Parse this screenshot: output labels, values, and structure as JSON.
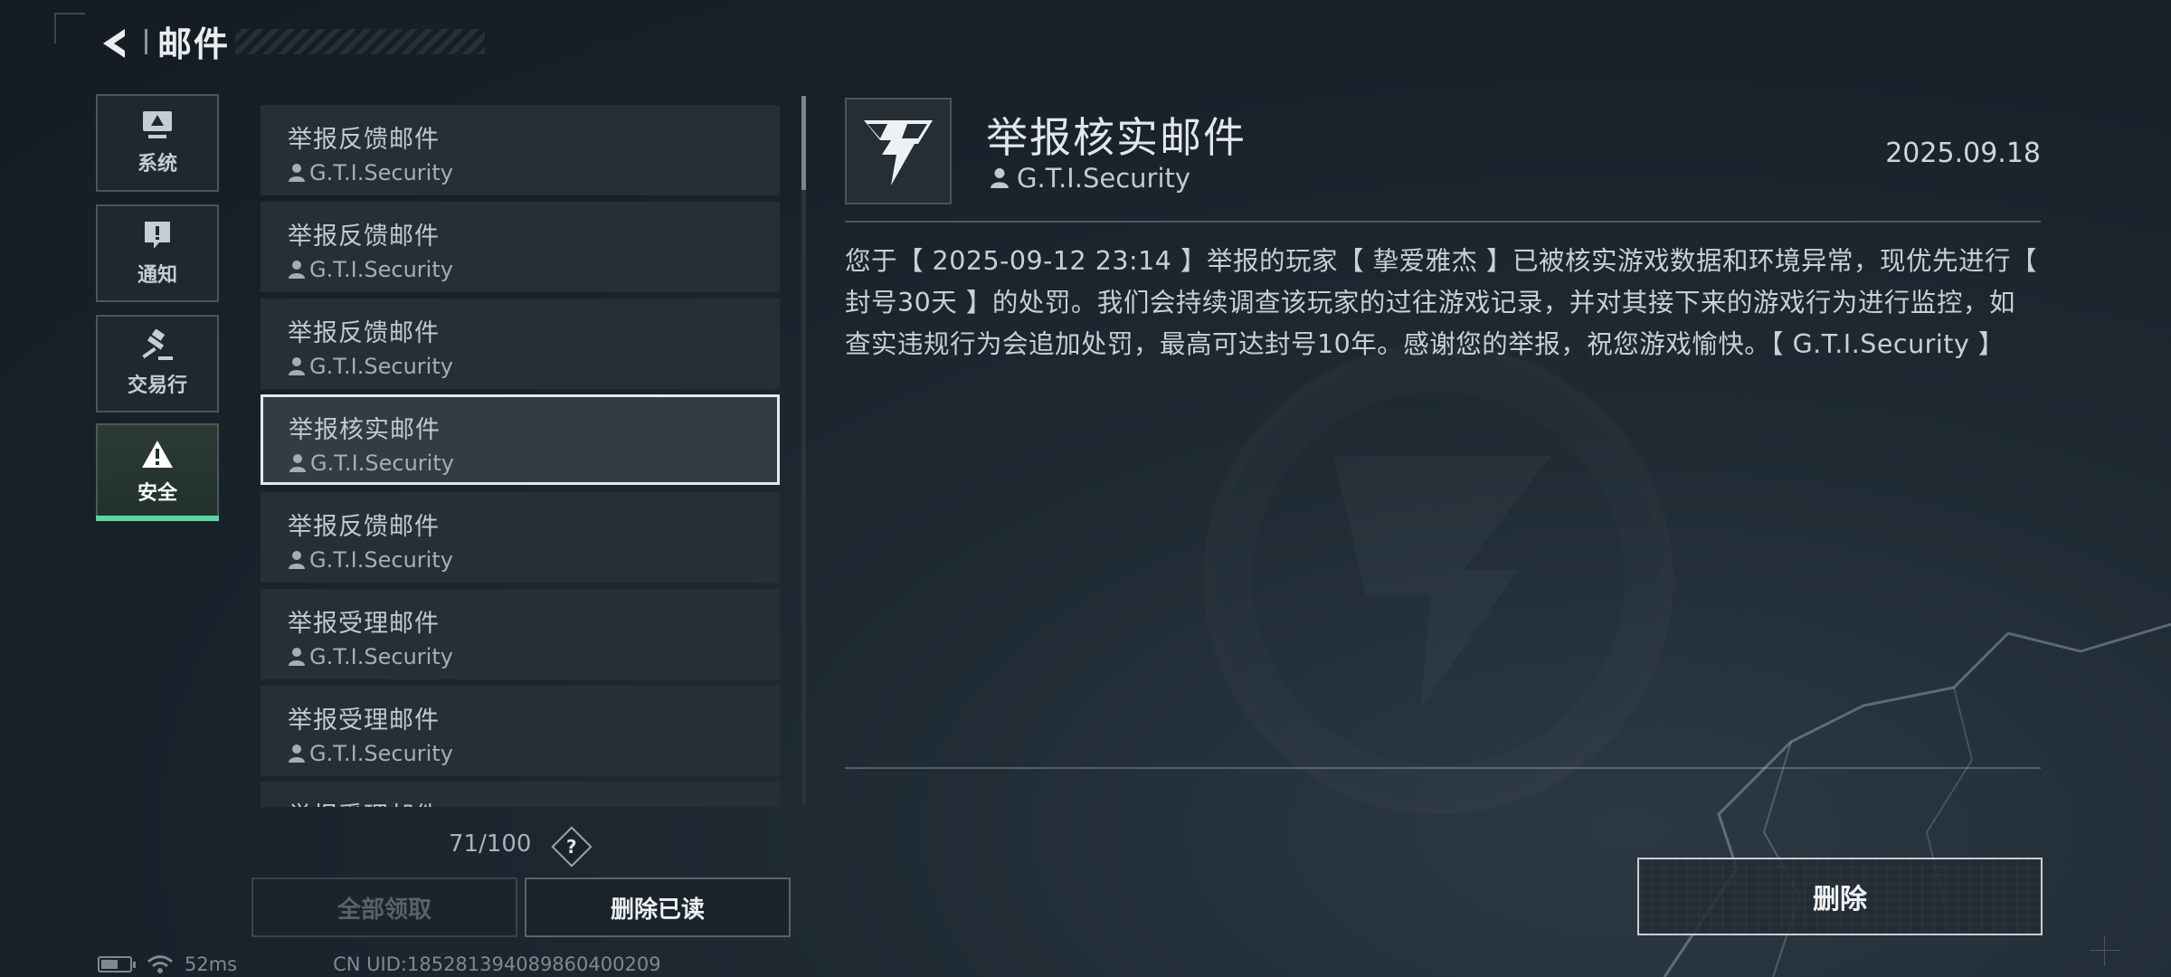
{
  "header": {
    "title": "邮件"
  },
  "sidebar": {
    "categories": [
      {
        "label": "系统",
        "icon": "monitor-icon"
      },
      {
        "label": "通知",
        "icon": "alert-square-icon"
      },
      {
        "label": "交易行",
        "icon": "gavel-icon"
      },
      {
        "label": "安全",
        "icon": "warning-triangle-icon",
        "active": true
      }
    ]
  },
  "mail_list": {
    "items": [
      {
        "subject": "举报反馈邮件",
        "sender": "G.T.I.Security"
      },
      {
        "subject": "举报反馈邮件",
        "sender": "G.T.I.Security"
      },
      {
        "subject": "举报反馈邮件",
        "sender": "G.T.I.Security"
      },
      {
        "subject": "举报核实邮件",
        "sender": "G.T.I.Security",
        "selected": true
      },
      {
        "subject": "举报反馈邮件",
        "sender": "G.T.I.Security"
      },
      {
        "subject": "举报受理邮件",
        "sender": "G.T.I.Security"
      },
      {
        "subject": "举报受理邮件",
        "sender": "G.T.I.Security"
      },
      {
        "subject": "举报受理邮件",
        "sender": ""
      }
    ],
    "count": "71/100",
    "help_label": "?",
    "claim_all_label": "全部领取",
    "delete_read_label": "删除已读"
  },
  "detail": {
    "title": "举报核实邮件",
    "sender": "G.T.I.Security",
    "date": "2025.09.18",
    "body": "您于【 2025-09-12 23:14 】举报的玩家【 挚爱雅杰 】已被核实游戏数据和环境异常，现优先进行【 封号30天 】的处罚。我们会持续调查该玩家的过往游戏记录，并对其接下来的游戏行为进行监控，如查实违规行为会追加处罚，最高可达封号10年。感谢您的举报，祝您游戏愉快。【 G.T.I.Security 】",
    "delete_label": "删除"
  },
  "status_bar": {
    "battery_level": 0.6,
    "ping": "52ms",
    "uid": "CN UID:1852813940898604002​09"
  },
  "colors": {
    "accent_green": "#5bd6a2",
    "selected_border": "#e6e9ec"
  }
}
